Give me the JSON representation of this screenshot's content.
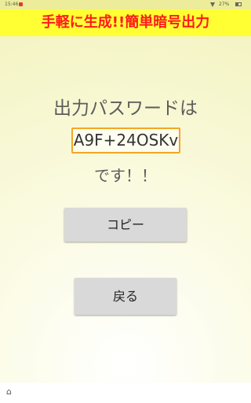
{
  "status_bar": {
    "time": "15:46",
    "battery": "27%"
  },
  "colors": {
    "title_red": "#ff1a1a",
    "title_bg": "#ffff33",
    "password_border": "#f5a623",
    "notif_red": "#e53935"
  },
  "app_bar": {
    "title": "手軽に生成!!簡単暗号出力"
  },
  "main": {
    "heading": "出力パスワードは",
    "password": "A9F+24OSKv",
    "suffix": "です！！"
  },
  "buttons": {
    "copy_label": "コピー",
    "back_label": "戻る"
  },
  "icons": {
    "home": "home-icon",
    "wifi": "wifi-icon",
    "battery": "battery-icon"
  }
}
